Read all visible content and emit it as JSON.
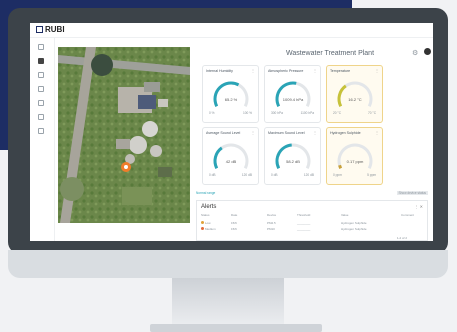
{
  "app": {
    "logo_text": "RUBI",
    "page_title": "Wastewater Treatment Plant"
  },
  "header_icons": [
    "gear-icon",
    "user-icon"
  ],
  "sidebar_icons": [
    "home-icon",
    "map-icon",
    "gauge-icon",
    "chart-icon",
    "bell-icon",
    "report-icon",
    "settings-icon"
  ],
  "widgets": [
    {
      "title": "Internal Humidity",
      "value": "65.2 %",
      "min": "0 %",
      "max": "100 %",
      "level": 0.62,
      "color": "#2aa4b6",
      "warn": false
    },
    {
      "title": "Atmospheric Pressure",
      "value": "1009.4 hPa",
      "min": "300 hPa",
      "max": "1100 hPa",
      "level": 0.55,
      "color": "#2aa4b6",
      "warn": false
    },
    {
      "title": "Temperature",
      "value": "16.2 °C",
      "min": "20 °C",
      "max": "70 °C",
      "level": 0.35,
      "color": "#c7c23a",
      "warn": true
    },
    {
      "title": "Average Sound Level",
      "value": "42 dB",
      "min": "0 dB",
      "max": "120 dB",
      "level": 0.35,
      "color": "#2aa4b6",
      "warn": false
    },
    {
      "title": "Maximum Sound Level",
      "value": "58.2 dB",
      "min": "0 dB",
      "max": "120 dB",
      "level": 0.48,
      "color": "#2aa4b6",
      "warn": false
    },
    {
      "title": "Hydrogen Sulphide",
      "value": "0.17 ppm",
      "min": "0 ppm",
      "max": "5 ppm",
      "level": 0.05,
      "color": "#c9a13a",
      "warn": true
    }
  ],
  "legend": {
    "left": "Normal range",
    "right": "Show device status"
  },
  "alerts": {
    "title": "Alerts",
    "tools": "⋮ ✕",
    "columns": [
      "Status",
      "Date",
      "Device",
      "Threshold",
      "Value",
      "Comment"
    ],
    "rows": [
      {
        "status": "Low",
        "status_color": "#e0a23a",
        "date": "15/6",
        "device": "PM2.5",
        "threshold": "________",
        "value": "Hydrogen Sulphide",
        "comment": ""
      },
      {
        "status": "Medium",
        "status_color": "#e36b3b",
        "date": "15/6",
        "device": "PM10",
        "threshold": "________",
        "value": "Hydrogen Sulphide",
        "comment": ""
      }
    ],
    "pager": "1-2 of 2"
  },
  "map": {
    "marker_color": "#f07d2a"
  }
}
